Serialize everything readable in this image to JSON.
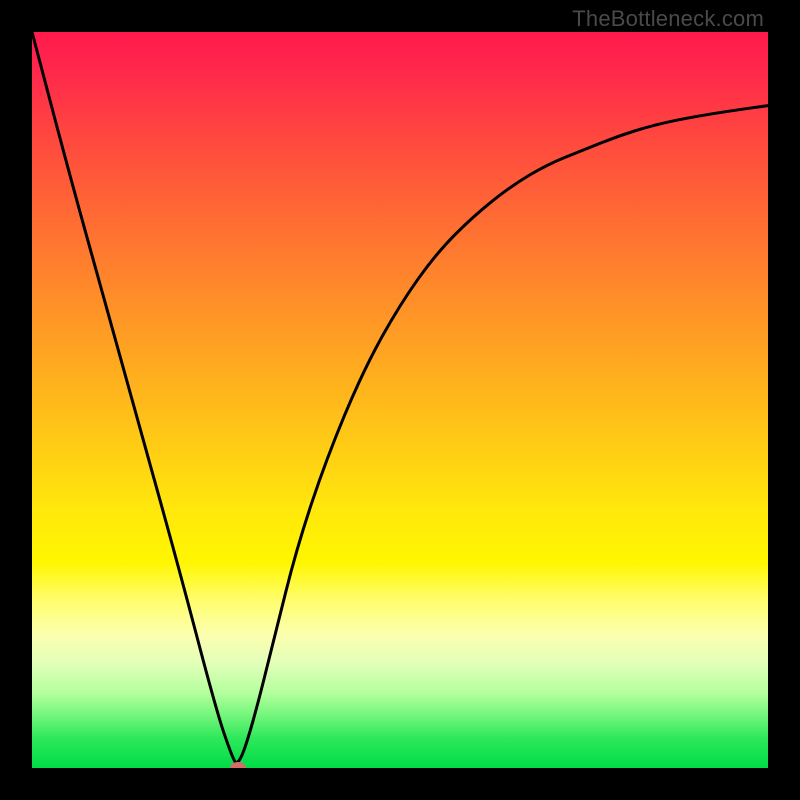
{
  "watermark": "TheBottleneck.com",
  "chart_data": {
    "type": "line",
    "title": "",
    "xlabel": "",
    "ylabel": "",
    "xlim": [
      0,
      100
    ],
    "ylim": [
      0,
      100
    ],
    "series": [
      {
        "name": "curve",
        "x": [
          0,
          5,
          10,
          15,
          20,
          25,
          27,
          28,
          30,
          33,
          36,
          40,
          45,
          50,
          55,
          60,
          65,
          70,
          75,
          80,
          85,
          90,
          95,
          100
        ],
        "values": [
          100,
          81,
          63,
          45,
          27,
          8,
          2,
          0,
          6,
          18,
          30,
          42,
          54,
          63,
          70,
          75,
          79,
          82,
          84,
          86,
          87.5,
          88.5,
          89.3,
          90
        ]
      }
    ],
    "marker": {
      "x": 28,
      "y": 0
    },
    "colors": {
      "curve_stroke": "#000000",
      "marker_fill": "#d86a6a",
      "gradient_top": "#ff1a4d",
      "gradient_bottom": "#00dc47"
    }
  }
}
